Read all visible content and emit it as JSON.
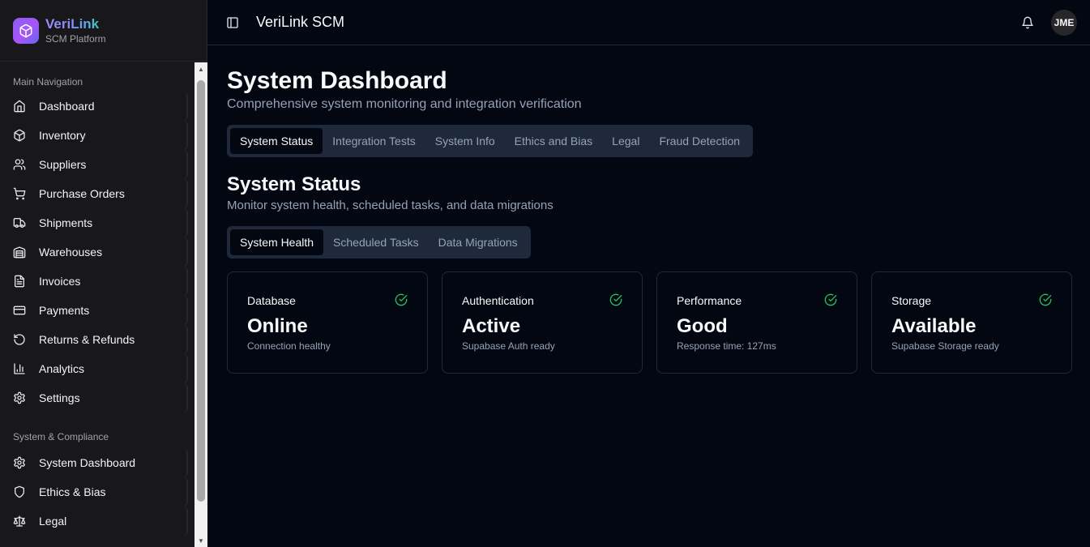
{
  "brand": {
    "name": "VeriLink",
    "subtitle": "SCM Platform"
  },
  "header": {
    "title": "VeriLink SCM",
    "avatar_initials": "JME"
  },
  "sidebar": {
    "main_group_label": "Main Navigation",
    "main_items": [
      {
        "label": "Dashboard",
        "icon": "home-icon"
      },
      {
        "label": "Inventory",
        "icon": "package-icon"
      },
      {
        "label": "Suppliers",
        "icon": "users-icon"
      },
      {
        "label": "Purchase Orders",
        "icon": "shopping-cart-icon"
      },
      {
        "label": "Shipments",
        "icon": "truck-icon"
      },
      {
        "label": "Warehouses",
        "icon": "warehouse-icon"
      },
      {
        "label": "Invoices",
        "icon": "file-text-icon"
      },
      {
        "label": "Payments",
        "icon": "credit-card-icon"
      },
      {
        "label": "Returns & Refunds",
        "icon": "rotate-ccw-icon"
      },
      {
        "label": "Analytics",
        "icon": "bar-chart-icon"
      },
      {
        "label": "Settings",
        "icon": "gear-icon"
      }
    ],
    "system_group_label": "System & Compliance",
    "system_items": [
      {
        "label": "System Dashboard",
        "icon": "gear-icon"
      },
      {
        "label": "Ethics & Bias",
        "icon": "shield-icon"
      },
      {
        "label": "Legal",
        "icon": "scale-icon"
      }
    ]
  },
  "page": {
    "title": "System Dashboard",
    "subtitle": "Comprehensive system monitoring and integration verification",
    "tabs": [
      "System Status",
      "Integration Tests",
      "System Info",
      "Ethics and Bias",
      "Legal",
      "Fraud Detection"
    ],
    "active_tab": "System Status"
  },
  "section": {
    "title": "System Status",
    "subtitle": "Monitor system health, scheduled tasks, and data migrations",
    "tabs": [
      "System Health",
      "Scheduled Tasks",
      "Data Migrations"
    ],
    "active_tab": "System Health"
  },
  "cards": [
    {
      "label": "Database",
      "value": "Online",
      "description": "Connection healthy"
    },
    {
      "label": "Authentication",
      "value": "Active",
      "description": "Supabase Auth ready"
    },
    {
      "label": "Performance",
      "value": "Good",
      "description": "Response time: 127ms"
    },
    {
      "label": "Storage",
      "value": "Available",
      "description": "Supabase Storage ready"
    }
  ],
  "colors": {
    "background": "#030711",
    "sidebar": "#18181b",
    "success": "#22c55e",
    "muted": "#94a3b8"
  }
}
